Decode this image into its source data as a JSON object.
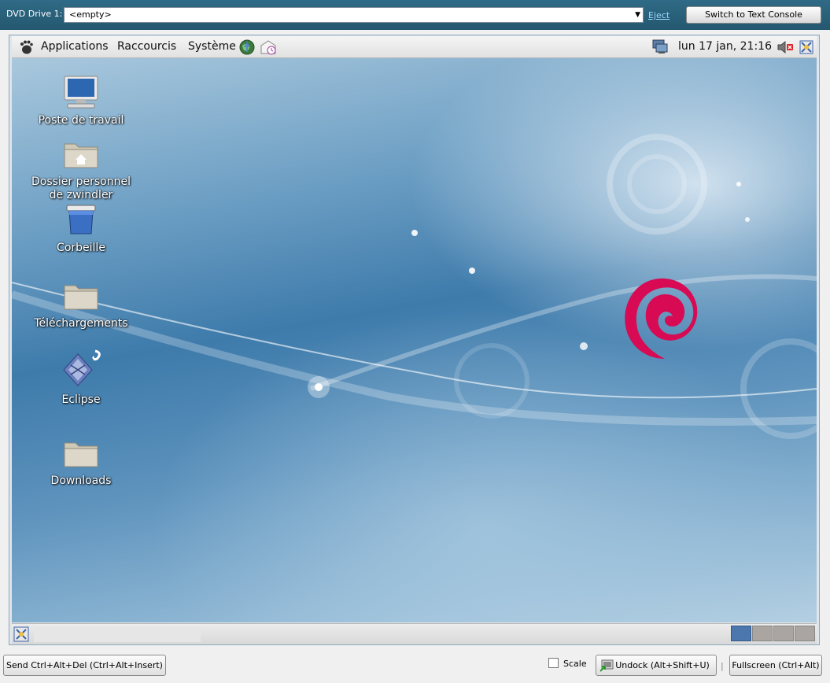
{
  "toolbar": {
    "dvd_label": "DVD Drive 1:",
    "dvd_value": "<empty>",
    "eject_label": "Eject",
    "switch_label": "Switch to Text Console"
  },
  "panel": {
    "menus": [
      "Applications",
      "Raccourcis",
      "Système"
    ],
    "clock": "lun 17 jan, 21:16"
  },
  "desktop": {
    "icons": [
      {
        "label": "Poste de travail",
        "icon": "computer-icon"
      },
      {
        "label": "Dossier personnel",
        "label2": "de zwindler",
        "icon": "home-folder-icon"
      },
      {
        "label": "Corbeille",
        "icon": "trash-icon"
      },
      {
        "label": "Téléchargements",
        "icon": "folder-icon"
      },
      {
        "label": "Eclipse",
        "icon": "eclipse-icon"
      },
      {
        "label": "Downloads",
        "icon": "folder-icon"
      }
    ]
  },
  "footer": {
    "send_cad_label": "Send Ctrl+Alt+Del (Ctrl+Alt+Insert)",
    "scale_label": "Scale",
    "undock_label": "Undock (Alt+Shift+U)",
    "fullscreen_label": "Fullscreen (Ctrl+Alt)"
  },
  "colors": {
    "topbar": "#2f6a86",
    "debian_red": "#d70a53",
    "workspace_active": "#4b76ae"
  }
}
